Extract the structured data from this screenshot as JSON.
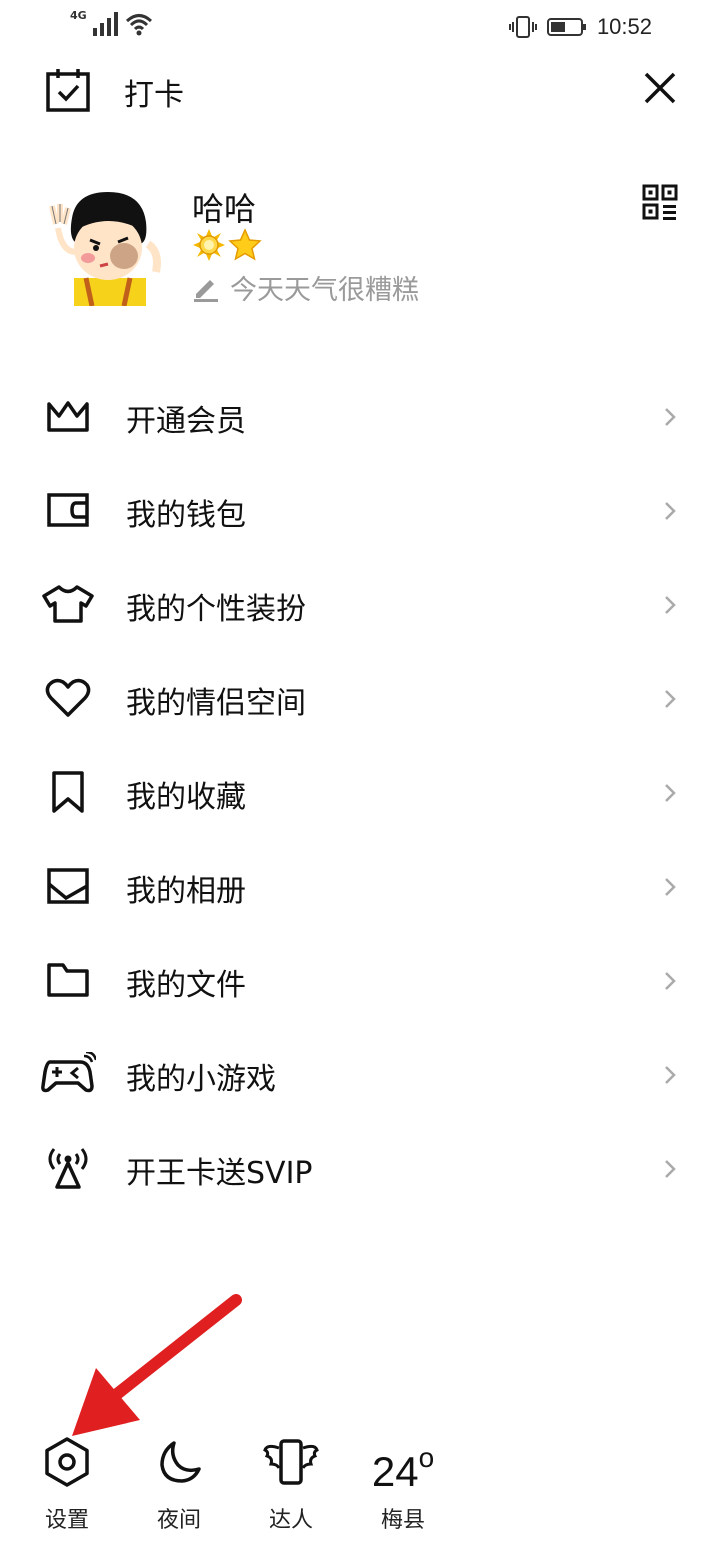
{
  "status_bar": {
    "network": "4G",
    "time": "10:52"
  },
  "header": {
    "checkin_label": "打卡"
  },
  "profile": {
    "username": "哈哈",
    "signature": "今天天气很糟糕"
  },
  "menu": [
    {
      "label": "开通会员",
      "icon": "crown-icon"
    },
    {
      "label": "我的钱包",
      "icon": "wallet-icon"
    },
    {
      "label": "我的个性装扮",
      "icon": "tshirt-icon"
    },
    {
      "label": "我的情侣空间",
      "icon": "heart-icon"
    },
    {
      "label": "我的收藏",
      "icon": "bookmark-icon"
    },
    {
      "label": "我的相册",
      "icon": "image-icon"
    },
    {
      "label": "我的文件",
      "icon": "folder-icon"
    },
    {
      "label": "我的小游戏",
      "icon": "gamepad-icon"
    },
    {
      "label": "开王卡送SVIP",
      "icon": "antenna-icon"
    }
  ],
  "bottom_bar": {
    "settings_label": "设置",
    "night_label": "夜间",
    "expert_label": "达人",
    "temperature": "24",
    "temperature_unit": "o",
    "city": "梅县"
  },
  "colors": {
    "annotation_arrow": "#e02020",
    "badge_gold": "#f5b800"
  }
}
